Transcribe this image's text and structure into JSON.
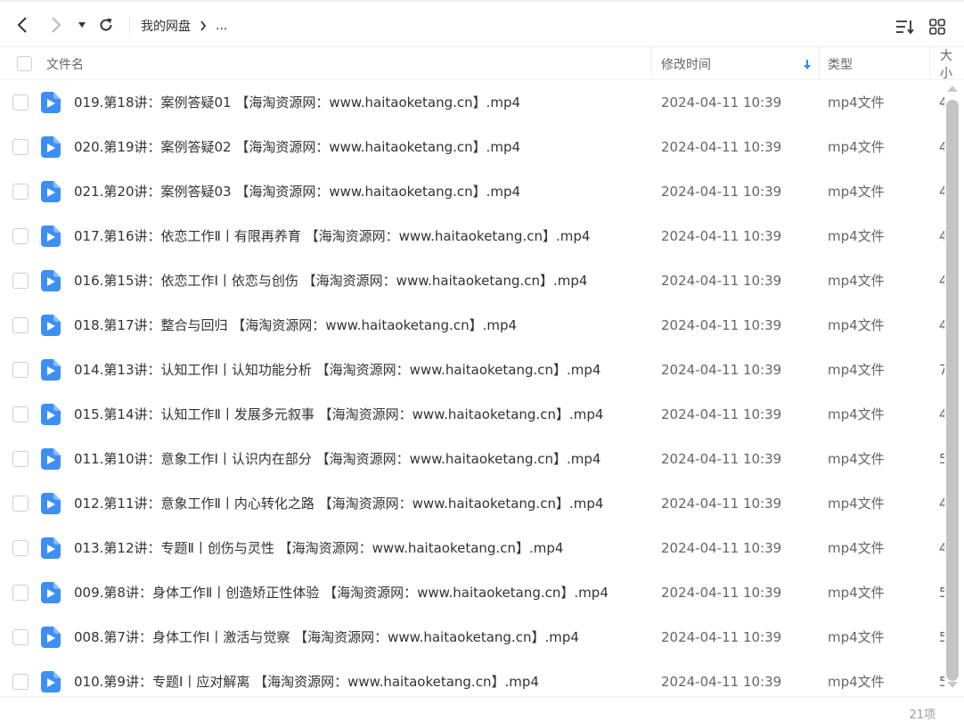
{
  "toolbar": {
    "breadcrumb_root": "我的网盘",
    "breadcrumb_more": "..."
  },
  "header": {
    "name": "文件名",
    "modified": "修改时间",
    "type": "类型",
    "size": "大小"
  },
  "files": [
    {
      "name": "019.第18讲：案例答疑01 【海淘资源网：www.haitaoketang.cn】.mp4",
      "modified": "2024-04-11 10:39",
      "type": "mp4文件",
      "size": "4"
    },
    {
      "name": "020.第19讲：案例答疑02 【海淘资源网：www.haitaoketang.cn】.mp4",
      "modified": "2024-04-11 10:39",
      "type": "mp4文件",
      "size": "4"
    },
    {
      "name": "021.第20讲：案例答疑03 【海淘资源网：www.haitaoketang.cn】.mp4",
      "modified": "2024-04-11 10:39",
      "type": "mp4文件",
      "size": "4"
    },
    {
      "name": "017.第16讲：依恋工作Ⅱ丨有限再养育 【海淘资源网：www.haitaoketang.cn】.mp4",
      "modified": "2024-04-11 10:39",
      "type": "mp4文件",
      "size": "4"
    },
    {
      "name": "016.第15讲：依恋工作Ⅰ丨依恋与创伤 【海淘资源网：www.haitaoketang.cn】.mp4",
      "modified": "2024-04-11 10:39",
      "type": "mp4文件",
      "size": "4"
    },
    {
      "name": "018.第17讲：整合与回归 【海淘资源网：www.haitaoketang.cn】.mp4",
      "modified": "2024-04-11 10:39",
      "type": "mp4文件",
      "size": "4"
    },
    {
      "name": "014.第13讲：认知工作Ⅰ丨认知功能分析 【海淘资源网：www.haitaoketang.cn】.mp4",
      "modified": "2024-04-11 10:39",
      "type": "mp4文件",
      "size": "7"
    },
    {
      "name": "015.第14讲：认知工作Ⅱ丨发展多元叙事 【海淘资源网：www.haitaoketang.cn】.mp4",
      "modified": "2024-04-11 10:39",
      "type": "mp4文件",
      "size": "4"
    },
    {
      "name": "011.第10讲：意象工作Ⅰ丨认识内在部分 【海淘资源网：www.haitaoketang.cn】.mp4",
      "modified": "2024-04-11 10:39",
      "type": "mp4文件",
      "size": "5"
    },
    {
      "name": "012.第11讲：意象工作Ⅱ丨内心转化之路 【海淘资源网：www.haitaoketang.cn】.mp4",
      "modified": "2024-04-11 10:39",
      "type": "mp4文件",
      "size": "4"
    },
    {
      "name": "013.第12讲：专题Ⅱ丨创伤与灵性 【海淘资源网：www.haitaoketang.cn】.mp4",
      "modified": "2024-04-11 10:39",
      "type": "mp4文件",
      "size": "4"
    },
    {
      "name": "009.第8讲：身体工作Ⅱ丨创造矫正性体验 【海淘资源网：www.haitaoketang.cn】.mp4",
      "modified": "2024-04-11 10:39",
      "type": "mp4文件",
      "size": "5"
    },
    {
      "name": "008.第7讲：身体工作Ⅰ丨激活与觉察 【海淘资源网：www.haitaoketang.cn】.mp4",
      "modified": "2024-04-11 10:39",
      "type": "mp4文件",
      "size": "5"
    },
    {
      "name": "010.第9讲：专题Ⅰ丨应对解离 【海淘资源网：www.haitaoketang.cn】.mp4",
      "modified": "2024-04-11 10:39",
      "type": "mp4文件",
      "size": "5"
    }
  ],
  "footer": {
    "count": "21项"
  },
  "colors": {
    "accent": "#2f8cf0",
    "file_icon": "#3d8ff5",
    "text": "#333333",
    "muted": "#666666"
  },
  "icons": {
    "back": "chevron-left-icon",
    "forward": "chevron-right-icon",
    "history": "caret-down-icon",
    "refresh": "refresh-icon",
    "sort": "sort-list-icon",
    "grid": "grid-view-icon",
    "file": "video-file-icon",
    "sort_desc": "arrow-down-icon"
  }
}
